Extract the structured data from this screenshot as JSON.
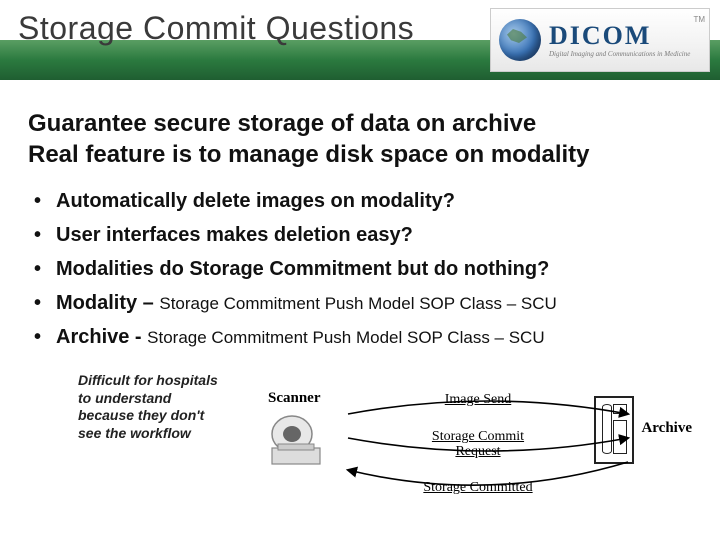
{
  "header": {
    "title": "Storage Commit Questions",
    "logo": {
      "main": "DICOM",
      "tagline": "Digital Imaging and Communications in Medicine",
      "tm": "TM"
    }
  },
  "headline": {
    "line1": "Guarantee secure storage of data on archive",
    "line2": "Real feature is to manage disk space on modality"
  },
  "bullets": [
    {
      "main": "Automatically delete images on modality?",
      "sub": ""
    },
    {
      "main": "User interfaces makes deletion easy?",
      "sub": ""
    },
    {
      "main": "Modalities do Storage Commitment but do nothing?",
      "sub": ""
    },
    {
      "main": "Modality – ",
      "sub": "Storage Commitment Push Model SOP Class – SCU"
    },
    {
      "main": "Archive - ",
      "sub": "Storage Commitment Push Model SOP Class – SCU"
    }
  ],
  "diagram": {
    "note": "Difficult for hospitals to understand because they don't see the workflow",
    "scanner": "Scanner",
    "archive": "Archive",
    "flows": {
      "send": "Image Send",
      "request": "Storage Commit Request",
      "committed": "Storage Committed"
    }
  }
}
